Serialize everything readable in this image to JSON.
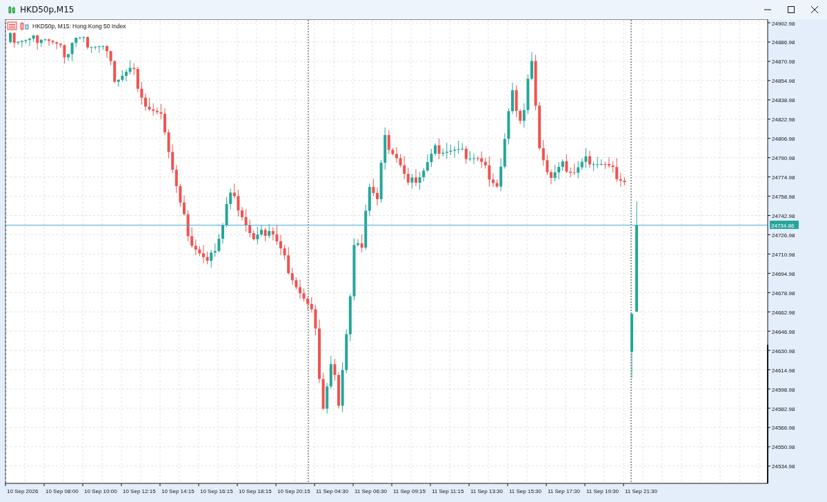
{
  "window": {
    "title": "HKD50p,M15"
  },
  "chart": {
    "header": "HKD50p, M15:  Hong Kong 50 Index",
    "price_ticks": [
      "24902.98",
      "24886.98",
      "24870.98",
      "24854.98",
      "24838.98",
      "24822.98",
      "24806.98",
      "24790.98",
      "24774.98",
      "24758.98",
      "24742.98",
      "24726.98",
      "24710.98",
      "24694.98",
      "24678.98",
      "24662.98",
      "24646.98",
      "24630.98",
      "24614.98",
      "24598.98",
      "24582.98",
      "24566.98",
      "24550.98",
      "24534.98"
    ],
    "current_price": "24734.86",
    "time_ticks": [
      "10 Sep 2026",
      "10 Sep 08:00",
      "10 Sep 10:00",
      "10 Sep 12:15",
      "10 Sep 14:15",
      "10 Sep 16:15",
      "10 Sep 18:15",
      "10 Sep 20:15",
      "11 Sep 04:30",
      "11 Sep 06:30",
      "11 Sep 09:15",
      "11 Sep 11:15",
      "11 Sep 13:30",
      "11 Sep 15:30",
      "11 Sep 17:30",
      "11 Sep 19:30",
      "11 Sep 21:30"
    ]
  }
}
